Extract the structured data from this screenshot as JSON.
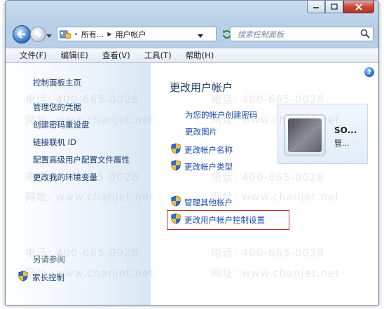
{
  "window": {
    "address": {
      "segments": [
        "所有...",
        "用户帐户"
      ],
      "overflow": "«"
    },
    "search_placeholder": "搜索控制面板"
  },
  "menu": [
    "文件(F)",
    "编辑(E)",
    "查看(V)",
    "工具(T)",
    "帮助(H)"
  ],
  "left": {
    "home": "控制面板主页",
    "links": [
      "管理您的凭据",
      "创建密码重设盘",
      "链接联机 ID",
      "配置高级用户配置文件属性",
      "更改我的环境变量"
    ],
    "see_also": "另请参阅",
    "family": "家长控制"
  },
  "main": {
    "title": "更改用户帐户",
    "links": [
      {
        "text": "为您的帐户创建密码",
        "shield": false
      },
      {
        "text": "更改图片",
        "shield": false
      },
      {
        "text": "更改帐户名称",
        "shield": true
      },
      {
        "text": "更改帐户类型",
        "shield": true
      },
      {
        "text": "管理其他帐户",
        "shield": true
      },
      {
        "text": "更改用户帐户控制设置",
        "shield": true
      }
    ]
  },
  "user": {
    "name": "SO...",
    "role": "管..."
  },
  "watermark": {
    "phone": "电话: 400-665-0028",
    "site": "网址: www.chanjet.net"
  },
  "colors": {
    "link": "#1748a5",
    "title": "#1e3b64",
    "highlight": "#c52e2e",
    "frame": "#b8cfe7"
  },
  "icons": [
    "back-arrow-icon",
    "forward-arrow-icon",
    "control-panel-icon",
    "refresh-icon",
    "search-icon",
    "help-icon",
    "shield-icon",
    "minimize-icon",
    "maximize-icon",
    "close-icon"
  ]
}
